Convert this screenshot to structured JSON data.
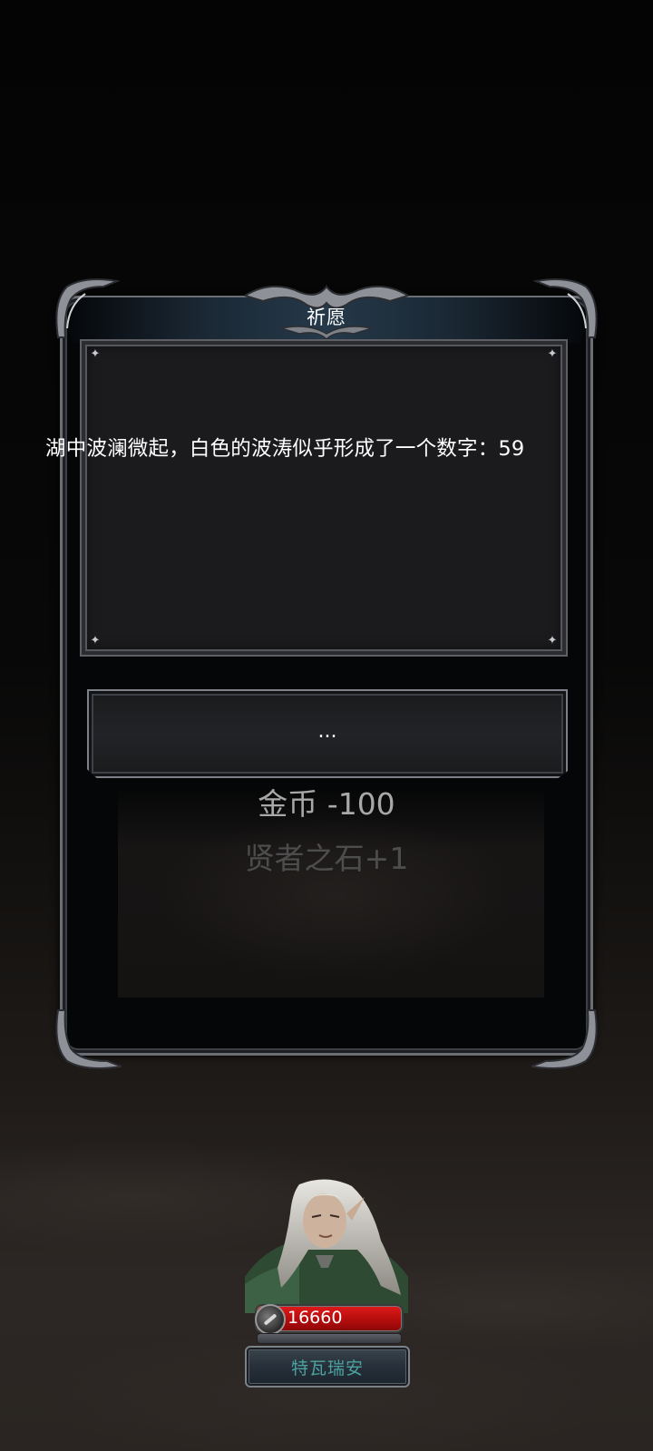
{
  "dialog": {
    "title": "祈愿",
    "story_text": "湖中波澜微起，白色的波涛似乎形成了一个数字：59",
    "choice_label": "...",
    "rewards": {
      "gold": "金币 -100",
      "item": "贤者之石+1"
    }
  },
  "hero": {
    "hp": "16660",
    "name": "特瓦瑞安"
  },
  "colors": {
    "hp_bar": "#c8141a",
    "name_text": "#4aa3a0",
    "gold_text": "#a8a8a8",
    "item_text": "#4d4d4e"
  }
}
